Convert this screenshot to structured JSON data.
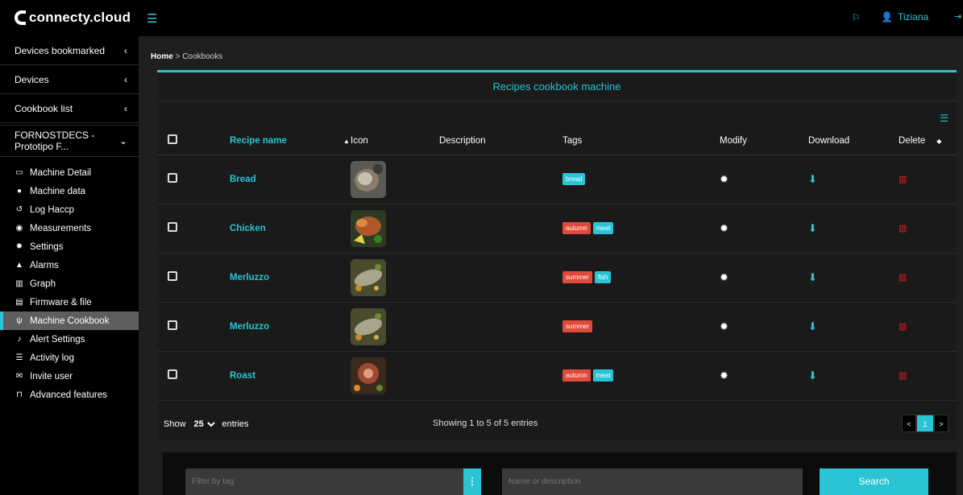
{
  "header": {
    "brand": "connecty.cloud",
    "user_name": "Tiziana"
  },
  "sidebar": {
    "groups": [
      {
        "label": "Devices bookmarked",
        "chevron": "‹"
      },
      {
        "label": "Devices",
        "chevron": "‹"
      },
      {
        "label": "Cookbook list",
        "chevron": "‹"
      }
    ],
    "machine": {
      "label": "FORNOSTDECS - Prototipo F...",
      "chevron": "⌄"
    },
    "items": [
      {
        "label": "Machine Detail",
        "icon": "monitor-icon"
      },
      {
        "label": "Machine data",
        "icon": "info-icon"
      },
      {
        "label": "Log Haccp",
        "icon": "history-icon"
      },
      {
        "label": "Measurements",
        "icon": "dashboard-icon"
      },
      {
        "label": "Settings",
        "icon": "gear-icon"
      },
      {
        "label": "Alarms",
        "icon": "warning-icon"
      },
      {
        "label": "Graph",
        "icon": "bar-chart-icon"
      },
      {
        "label": "Firmware & file",
        "icon": "file-icon"
      },
      {
        "label": "Machine Cookbook",
        "icon": "cutlery-icon"
      },
      {
        "label": "Alert Settings",
        "icon": "bell-icon"
      },
      {
        "label": "Activity log",
        "icon": "list-icon"
      },
      {
        "label": "Invite user",
        "icon": "envelope-icon"
      },
      {
        "label": "Advanced features",
        "icon": "unlock-icon"
      }
    ]
  },
  "breadcrumb": {
    "home": "Home",
    "separator": ">",
    "current": "Cookbooks"
  },
  "panel": {
    "title": "Recipes cookbook machine",
    "columns": [
      "Recipe name",
      "Icon",
      "Description",
      "Tags",
      "Modify",
      "Download",
      "Delete"
    ],
    "rows": [
      {
        "name": "Bread",
        "description": "",
        "tags": [
          {
            "text": "bread",
            "color": "teal"
          }
        ]
      },
      {
        "name": "Chicken",
        "description": "",
        "tags": [
          {
            "text": "autumn",
            "color": "red"
          },
          {
            "text": "meat",
            "color": "teal"
          }
        ]
      },
      {
        "name": "Merluzzo",
        "description": "",
        "tags": [
          {
            "text": "summer",
            "color": "red"
          },
          {
            "text": "fish",
            "color": "teal"
          }
        ]
      },
      {
        "name": "Merluzzo",
        "description": "",
        "tags": [
          {
            "text": "summer",
            "color": "red"
          }
        ]
      },
      {
        "name": "Roast",
        "description": "",
        "tags": [
          {
            "text": "autumn",
            "color": "red"
          },
          {
            "text": "meat",
            "color": "teal"
          }
        ]
      }
    ],
    "show_label": "Show",
    "entries_value": "25",
    "entries_label": "entries",
    "showing_text": "Showing 1 to 5 of 5 entries",
    "pager": {
      "prev": "<",
      "current": "1",
      "next": ">"
    }
  },
  "filters": {
    "tag_placeholder": "Filter by tag",
    "name_placeholder": "Name or description",
    "search_label": "Search"
  },
  "colors": {
    "accent": "#2bc4d4",
    "danger": "#e04a3a"
  }
}
